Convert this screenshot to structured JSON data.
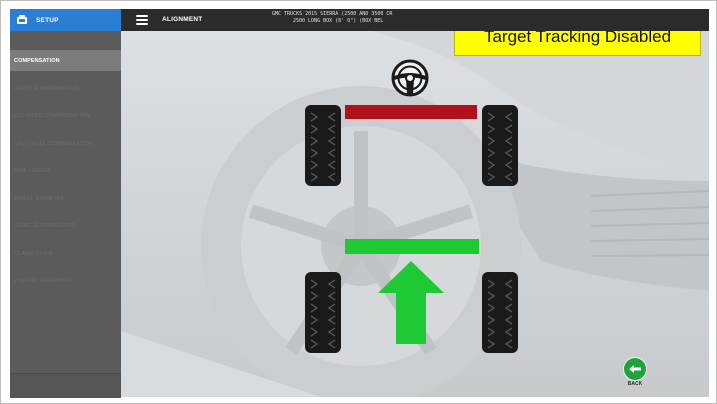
{
  "sidebar": {
    "header_label": "SETUP",
    "header_icon": "setup-gear-icon",
    "items": [
      {
        "label": "COMPENSATION",
        "active": true
      },
      {
        "label": "VEHICLE INFORMATION"
      },
      {
        "label": "ELEVATED COMPENSATION"
      },
      {
        "label": "SPLIT ROLL COMPENSATION"
      },
      {
        "label": "RIDE HEIGHT"
      },
      {
        "label": "WHEEL DIAMETER"
      },
      {
        "label": "VEHICLE DIMENSIONS"
      },
      {
        "label": "CLAMP STYLE"
      },
      {
        "label": "2 WHEEL ALIGNMENT"
      }
    ]
  },
  "topbar": {
    "menu_icon": "hamburger-menu-icon",
    "title": "ALIGNMENT",
    "vehicle_line1": "GMC TRUCKS 2015 SIERRA (2500 AND 3500 CR",
    "vehicle_line2": "2500 LONG BOX (8' 0\") (BOX BEL"
  },
  "banner": {
    "text": "Target Tracking Disabled",
    "color": "#ffff00"
  },
  "diagram": {
    "steering_icon": "steering-wheel-icon",
    "front_axle_color": "#b0111a",
    "rear_axle_color": "#1ec934",
    "arrow_icon": "forward-arrow-icon",
    "arrow_color": "#1ec934"
  },
  "back_button": {
    "label": "BACK",
    "icon": "back-arrow-icon",
    "color": "#1fa33b"
  }
}
